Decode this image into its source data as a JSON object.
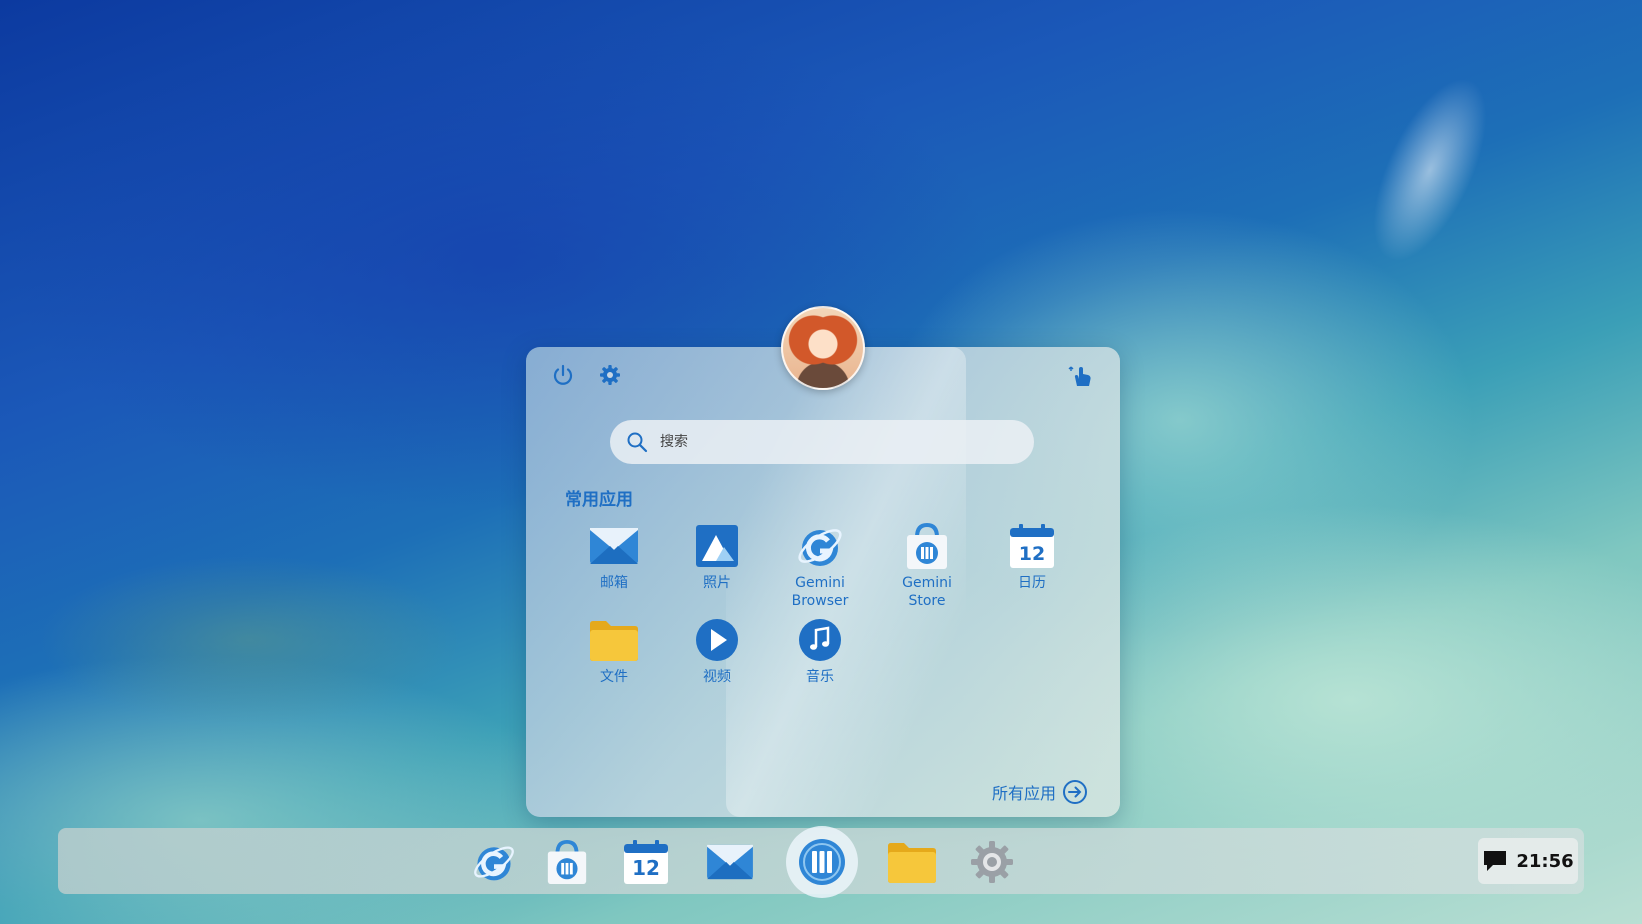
{
  "start_menu": {
    "search": {
      "placeholder": "搜索"
    },
    "section_title": "常用应用",
    "pinned_apps": [
      {
        "label": "邮箱",
        "icon": "mail-icon"
      },
      {
        "label": "照片",
        "icon": "photos-icon"
      },
      {
        "label": "Gemini Browser",
        "icon": "gemini-browser-icon"
      },
      {
        "label": "Gemini Store",
        "icon": "gemini-store-icon"
      },
      {
        "label": "日历",
        "icon": "calendar-icon"
      },
      {
        "label": "文件",
        "icon": "folder-icon"
      },
      {
        "label": "视频",
        "icon": "video-icon"
      },
      {
        "label": "音乐",
        "icon": "music-icon"
      }
    ],
    "calendar_day": "12",
    "all_apps_label": "所有应用"
  },
  "taskbar": {
    "items": [
      {
        "name": "gemini-browser",
        "icon": "gemini-browser-icon"
      },
      {
        "name": "gemini-store",
        "icon": "gemini-store-icon"
      },
      {
        "name": "calendar",
        "icon": "calendar-icon"
      },
      {
        "name": "mail",
        "icon": "mail-icon"
      },
      {
        "name": "launcher",
        "icon": "launcher-icon"
      },
      {
        "name": "files",
        "icon": "folder-icon"
      },
      {
        "name": "settings",
        "icon": "settings-icon"
      }
    ],
    "calendar_day": "12",
    "clock": "21:56"
  },
  "colors": {
    "accent": "#1f6fc4",
    "folder": "#f4c430"
  }
}
